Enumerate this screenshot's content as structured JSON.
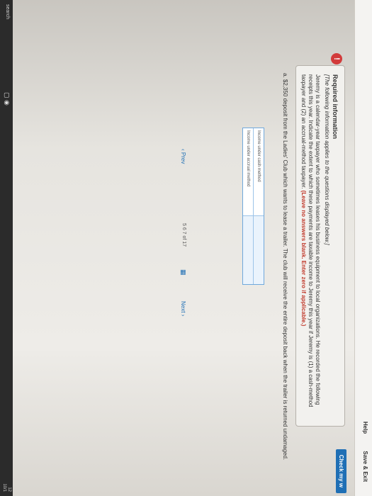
{
  "topbar": {
    "help": "Help",
    "save_exit": "Save & Exit",
    "check": "Check my w"
  },
  "alert": "!",
  "card": {
    "title": "Required information",
    "subtitle": "[The following information applies to the questions displayed below.]",
    "body": "Jeremy is a calendar-year taxpayer who sometimes leases his business equipment to local organizations. He recorded the following receipts this year. Indicate the extent to which these payments are taxable income to Jeremy this year if Jeremy is (1) a cash-method taxpayer and (2) an accrual-method taxpayer.",
    "instruction": "(Leave no answers blank. Enter zero if applicable.)"
  },
  "question": "a. $2,350 deposit from the Ladies' Club which wants to lease a trailer. The club will receive the entire deposit back when the trailer is returned undamaged.",
  "table": {
    "rows": [
      {
        "label": "Income under cash method"
      },
      {
        "label": "Income under accrual method"
      }
    ]
  },
  "nav": {
    "prev": "Prev",
    "pages": "5  6  7  of 17",
    "next": "Next"
  },
  "taskbar": {
    "search": "search",
    "time": "12",
    "date": "10/1"
  }
}
